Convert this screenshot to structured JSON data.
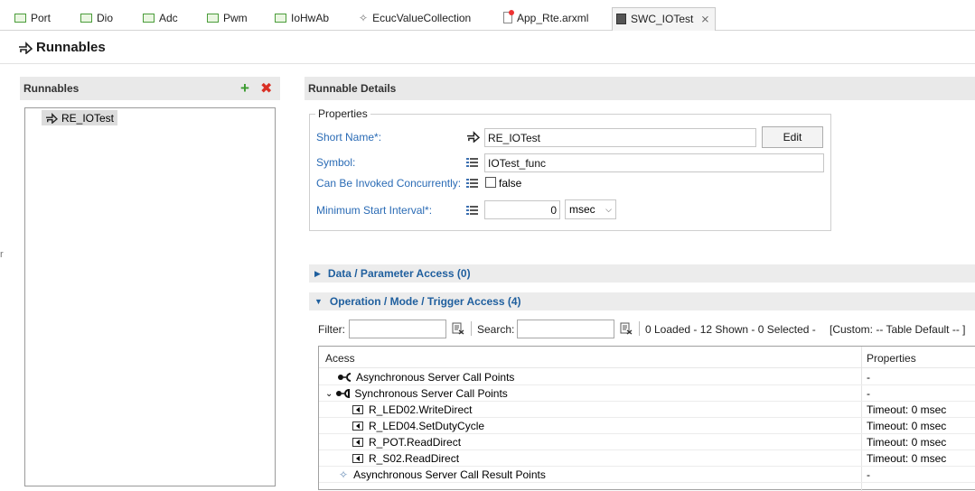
{
  "tabs": [
    {
      "label": "Port",
      "icon": "module-icon"
    },
    {
      "label": "Dio",
      "icon": "module-icon"
    },
    {
      "label": "Adc",
      "icon": "module-icon"
    },
    {
      "label": "Pwm",
      "icon": "module-icon"
    },
    {
      "label": "IoHwAb",
      "icon": "module-icon"
    },
    {
      "label": "EcucValueCollection",
      "icon": "collection-icon"
    },
    {
      "label": "App_Rte.arxml",
      "icon": "arxml-file-icon"
    },
    {
      "label": "SWC_IOTest",
      "icon": "swc-icon",
      "active": true
    }
  ],
  "editor": {
    "title": "Runnables"
  },
  "left_edge_text": "r",
  "runnables_panel": {
    "title": "Runnables",
    "items": [
      "RE_IOTest"
    ]
  },
  "details": {
    "title": "Runnable Details",
    "properties_legend": "Properties",
    "short_name_label": "Short Name*:",
    "short_name_value": "RE_IOTest",
    "edit_button": "Edit",
    "symbol_label": "Symbol:",
    "symbol_value": "IOTest_func",
    "concurrent_label": "Can Be Invoked Concurrently:",
    "concurrent_value": "false",
    "min_start_label": "Minimum Start Interval*:",
    "min_start_value": "0",
    "min_start_unit": "msec"
  },
  "sections": {
    "data_access": "Data / Parameter Access (0)",
    "operation_access": "Operation / Mode / Trigger Access (4)"
  },
  "filter_bar": {
    "filter_label": "Filter:",
    "search_label": "Search:",
    "status": "0 Loaded - 12 Shown - 0 Selected -",
    "custom": "[Custom: -- Table Default -- ]"
  },
  "table": {
    "col_access": "Acess",
    "col_properties": "Properties",
    "rows": [
      {
        "label": "Asynchronous Server Call Points",
        "props": "-",
        "indent": 0,
        "icon": "async-call-icon"
      },
      {
        "label": "Synchronous Server Call Points",
        "props": "-",
        "indent": 0,
        "icon": "sync-call-icon",
        "expanded": true
      },
      {
        "label": "R_LED02.WriteDirect",
        "props": "Timeout: 0 msec",
        "indent": 1,
        "icon": "operation-icon"
      },
      {
        "label": "R_LED04.SetDutyCycle",
        "props": "Timeout: 0 msec",
        "indent": 1,
        "icon": "operation-icon"
      },
      {
        "label": "R_POT.ReadDirect",
        "props": "Timeout: 0 msec",
        "indent": 1,
        "icon": "operation-icon"
      },
      {
        "label": "R_S02.ReadDirect",
        "props": "Timeout: 0 msec",
        "indent": 1,
        "icon": "operation-icon"
      },
      {
        "label": "Asynchronous Server Call Result Points",
        "props": "-",
        "indent": 0,
        "icon": "result-point-icon"
      }
    ]
  },
  "colors": {
    "label_blue": "#2a6bb5",
    "section_blue": "#1f5f9e",
    "delete_red": "#d93025",
    "add_green": "#3a9a2e"
  }
}
